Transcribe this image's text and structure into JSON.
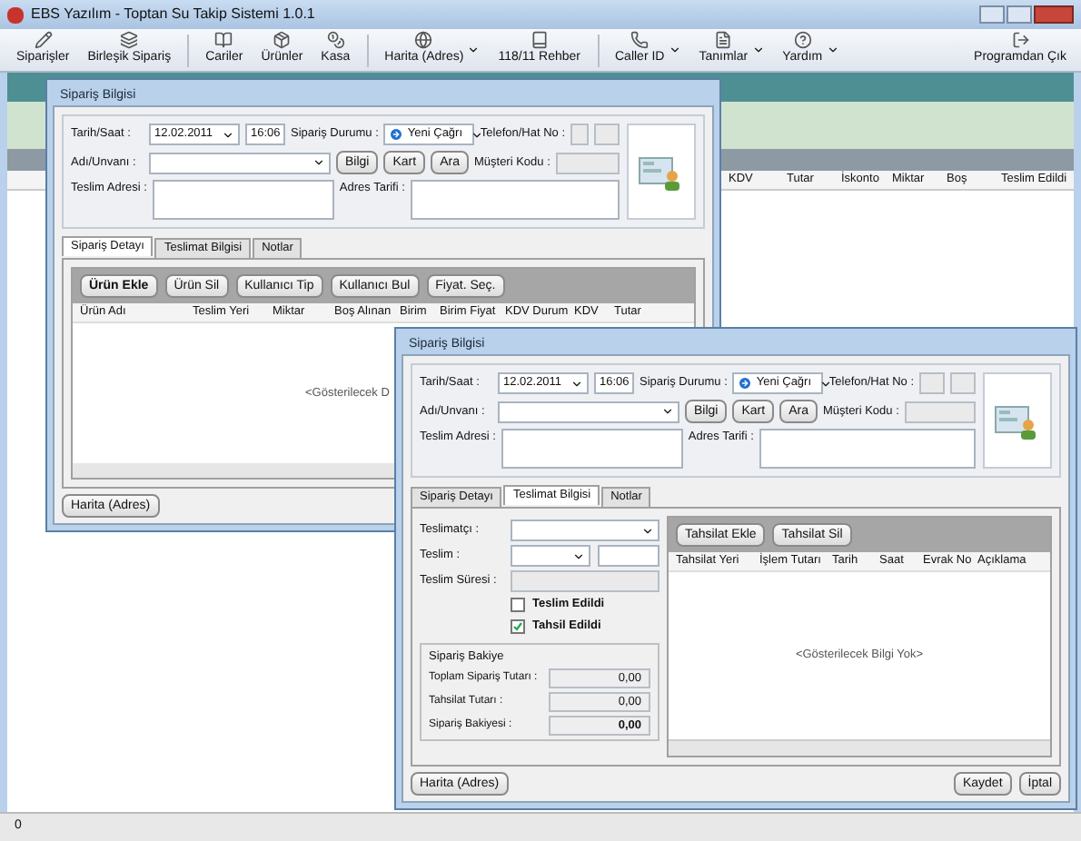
{
  "app": {
    "title": "EBS Yazılım - Toptan Su Takip Sistemi 1.0.1"
  },
  "toolbar": [
    {
      "label": "Siparişler",
      "dropdown": false
    },
    {
      "label": "Birleşik Sipariş",
      "dropdown": false
    },
    {
      "label": "Cariler",
      "dropdown": false
    },
    {
      "label": "Ürünler",
      "dropdown": false
    },
    {
      "label": "Kasa",
      "dropdown": false
    },
    {
      "label": "Harita (Adres)",
      "dropdown": true
    },
    {
      "label": "118/11 Rehber",
      "dropdown": false
    },
    {
      "label": "Caller ID",
      "dropdown": true
    },
    {
      "label": "Tanımlar",
      "dropdown": true
    },
    {
      "label": "Yardım",
      "dropdown": true
    }
  ],
  "toolbar_right": {
    "label": "Programdan Çık"
  },
  "background_table": {
    "columns": [
      "KDV",
      "Tutar",
      "İskonto",
      "Miktar",
      "Boş",
      "Teslim Edildi"
    ]
  },
  "status_bar": {
    "text": "0"
  },
  "windows": [
    {
      "title": "Sipariş Bilgisi",
      "form": {
        "date_label": "Tarih/Saat :",
        "date": "12.02.2011",
        "time": "16:06",
        "status_label": "Sipariş Durumu :",
        "status": "Yeni Çağrı",
        "phone_label": "Telefon/Hat No :",
        "name_label": "Adı/Unvanı :",
        "buttons": [
          "Bilgi",
          "Kart",
          "Ara"
        ],
        "code_label": "Müşteri Kodu :",
        "address_label": "Teslim Adresi :",
        "directions_label": "Adres Tarifi :"
      },
      "tabs": [
        {
          "label": "Sipariş Detayı",
          "selected": true
        },
        {
          "label": "Teslimat Bilgisi",
          "selected": false
        },
        {
          "label": "Notlar",
          "selected": false
        }
      ],
      "content": {
        "kind": "products",
        "buttons": [
          {
            "label": "Ürün Ekle",
            "bold": true
          },
          {
            "label": "Ürün Sil",
            "bold": false
          },
          {
            "label": "Kullanıcı Tip",
            "bold": false
          },
          {
            "label": "Kullanıcı Bul",
            "bold": false
          },
          {
            "label": "Fiyat. Seç.",
            "bold": false
          }
        ],
        "columns": [
          "Ürün Adı",
          "Teslim Yeri",
          "Miktar",
          "Boş Alınan",
          "Birim",
          "Birim Fiyat",
          "KDV Durum",
          "KDV",
          "Tutar"
        ],
        "empty": "<Gösterilecek D"
      },
      "map_button": "Harita (Adres)"
    },
    {
      "title": "Sipariş Bilgisi",
      "form": {
        "date_label": "Tarih/Saat :",
        "date": "12.02.2011",
        "time": "16:06",
        "status_label": "Sipariş Durumu :",
        "status": "Yeni Çağrı",
        "phone_label": "Telefon/Hat No :",
        "name_label": "Adı/Unvanı :",
        "buttons": [
          "Bilgi",
          "Kart",
          "Ara"
        ],
        "code_label": "Müşteri Kodu :",
        "address_label": "Teslim Adresi :",
        "directions_label": "Adres Tarifi :"
      },
      "tabs": [
        {
          "label": "Sipariş Detayı",
          "selected": false
        },
        {
          "label": "Teslimat Bilgisi",
          "selected": true
        },
        {
          "label": "Notlar",
          "selected": false
        }
      ],
      "content": {
        "kind": "delivery",
        "courier_label": "Teslimatçı :",
        "delivery_label": "Teslim :",
        "duration_label": "Teslim Süresi :",
        "checks": [
          {
            "label": "Teslim Edildi",
            "checked": false
          },
          {
            "label": "Tahsil Edildi",
            "checked": true
          }
        ],
        "balance": {
          "title": "Sipariş Bakiye",
          "rows": [
            {
              "label": "Toplam Sipariş Tutarı :",
              "value": "0,00",
              "bold": false
            },
            {
              "label": "Tahsilat Tutarı :",
              "value": "0,00",
              "bold": false
            },
            {
              "label": "Sipariş Bakiyesi :",
              "value": "0,00",
              "bold": true
            }
          ]
        },
        "buttons": [
          {
            "label": "Tahsilat Ekle",
            "bold": false
          },
          {
            "label": "Tahsilat Sil",
            "bold": false
          }
        ],
        "columns": [
          "Tahsilat Yeri",
          "İşlem Tutarı",
          "Tarih",
          "Saat",
          "Evrak No",
          "Açıklama"
        ],
        "empty": "<Gösterilecek Bilgi Yok>"
      },
      "map_button": "Harita (Adres)",
      "actions": [
        "Kaydet",
        "İptal"
      ]
    }
  ]
}
